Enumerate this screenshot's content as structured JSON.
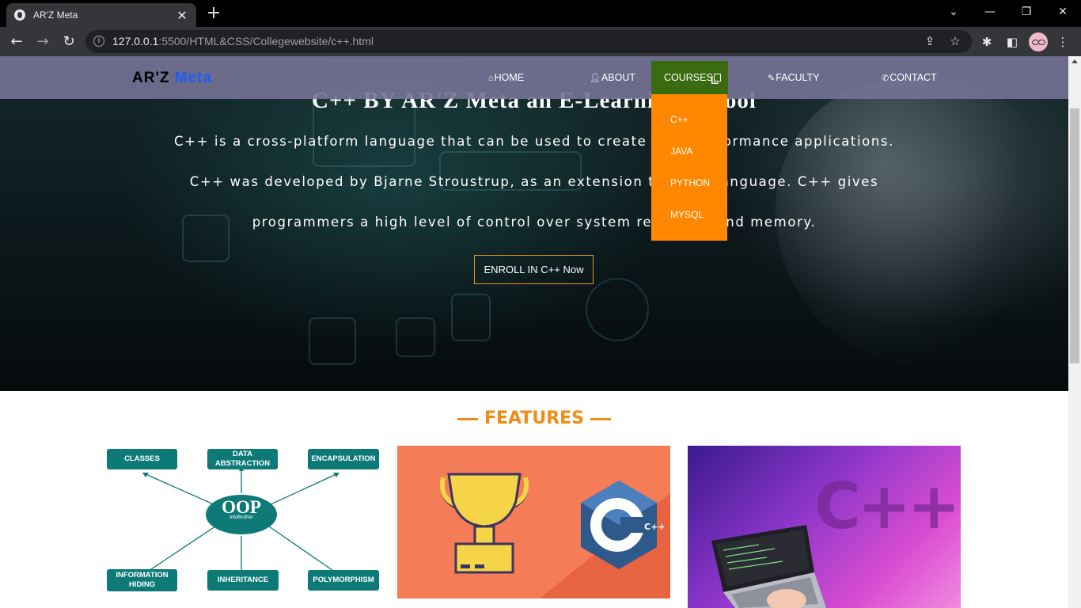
{
  "browser": {
    "tab_title": "AR'Z Meta",
    "new_tab": "+",
    "url_host": "127.0.0.1",
    "url_rest": ":5500/HTML&CSS/Collegewebsite/c++.html"
  },
  "site": {
    "logo_main": "AR'Z ",
    "logo_accent": "Meta",
    "nav": {
      "home": "HOME",
      "about": "ABOUT",
      "courses": "COURSES",
      "faculty": "FACULTY",
      "contact": "CONTACT"
    },
    "dropdown": [
      "C++",
      "JAVA",
      "PYTHON",
      "MYSQL"
    ]
  },
  "hero": {
    "title": "C++ BY AR'Z Meta an E-Learning School",
    "line1": "C++ is a cross-platform language that can be used to create high-performance applications.",
    "line2": "C++ was developed by Bjarne Stroustrup, as an extension to the C language. C++ gives",
    "line3": "programmers a high level of control over system resources and memory.",
    "button": "ENROLL IN C++ Now"
  },
  "features": {
    "heading": "FEATURES",
    "oop": {
      "center": "OOP",
      "center_sub": "InfoBrother",
      "boxes": [
        "CLASSES",
        "DATA ABSTRACTION",
        "ENCAPSULATION",
        "INFORMATION HIDING",
        "INHERITANCE",
        "POLYMORPHISM"
      ]
    },
    "cpp_badge": "C++",
    "cpp_big": "C++"
  },
  "colors": {
    "accent_orange": "#ff8800",
    "features_orange": "#f08c12",
    "courses_green": "#3a6b10",
    "logo_blue": "#1a5df5",
    "oop_teal": "#0e7a78"
  }
}
